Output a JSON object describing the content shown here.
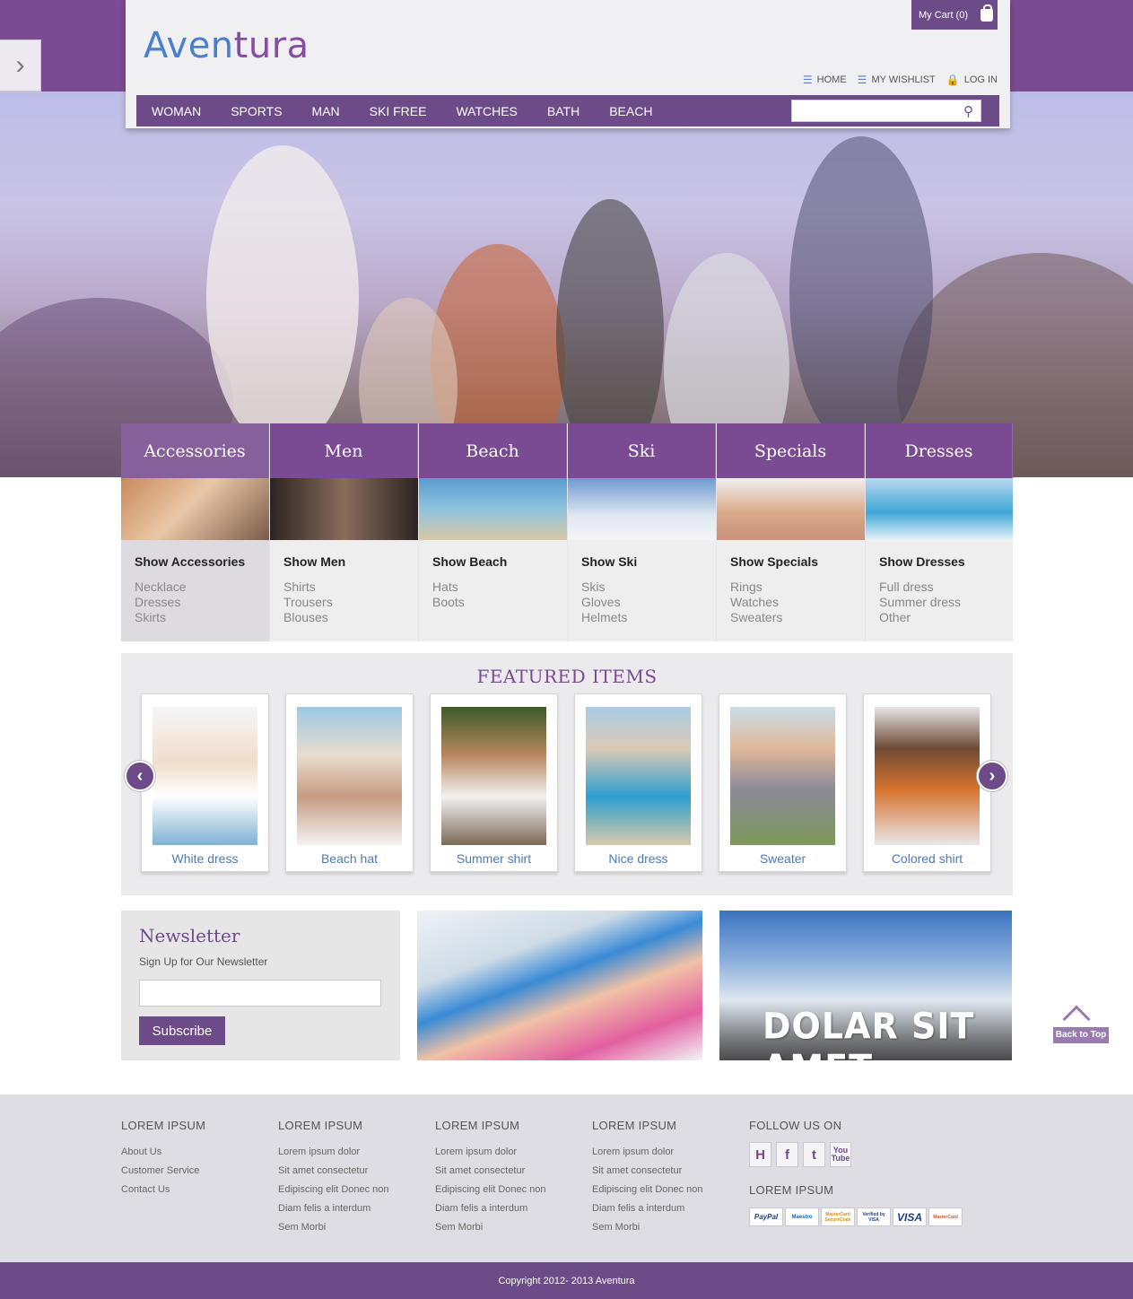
{
  "brand": {
    "logo_main": "Aven",
    "logo_tail": "tura"
  },
  "header": {
    "cart_label": "My Cart (0)",
    "top_links": [
      {
        "label": "HOME",
        "icon": "list-icon"
      },
      {
        "label": "MY WISHLIST",
        "icon": "list-icon"
      },
      {
        "label": "LOG IN",
        "icon": "lock-icon"
      }
    ],
    "nav": [
      "WOMAN",
      "SPORTS",
      "MAN",
      "SKI FREE",
      "WATCHES",
      "BATH",
      "BEACH"
    ],
    "search_placeholder": ""
  },
  "categories": [
    {
      "name": "Accessories",
      "show": "Show Accessories",
      "links": [
        "Necklace",
        "Dresses",
        "Skirts"
      ]
    },
    {
      "name": "Men",
      "show": "Show Men",
      "links": [
        "Shirts",
        "Trousers",
        "Blouses"
      ]
    },
    {
      "name": "Beach",
      "show": "Show Beach",
      "links": [
        "Hats",
        "Boots"
      ]
    },
    {
      "name": "Ski",
      "show": "Show Ski",
      "links": [
        "Skis",
        "Gloves",
        "Helmets"
      ]
    },
    {
      "name": "Specials",
      "show": "Show Specials",
      "links": [
        "Rings",
        "Watches",
        "Sweaters"
      ]
    },
    {
      "name": "Dresses",
      "show": "Show Dresses",
      "links": [
        "Full dress",
        "Summer dress",
        "Other"
      ]
    }
  ],
  "featured": {
    "title": "FEATURED ITEMS",
    "items": [
      "White dress",
      "Beach hat",
      "Summer shirt",
      "Nice dress",
      "Sweater",
      "Colored shirt"
    ]
  },
  "newsletter": {
    "title": "Newsletter",
    "subtitle": "Sign Up for Our Newsletter",
    "input_value": "",
    "button": "Subscribe"
  },
  "promo": {
    "banner_text": "DOLAR SIT AMET"
  },
  "back_to_top": "Back to Top",
  "footer": {
    "columns": [
      {
        "title": "LOREM IPSUM",
        "links": [
          "About Us",
          "Customer Service",
          "Contact Us"
        ]
      },
      {
        "title": "LOREM IPSUM",
        "links": [
          "Lorem ipsum dolor",
          "Sit amet consectetur",
          "Edipiscing elit Donec non",
          "Diam felis a interdum",
          "Sem Morbi"
        ]
      },
      {
        "title": "LOREM IPSUM",
        "links": [
          "Lorem ipsum dolor",
          "Sit amet consectetur",
          "Edipiscing elit Donec non",
          "Diam felis a interdum",
          "Sem Morbi"
        ]
      },
      {
        "title": "LOREM IPSUM",
        "links": [
          "Lorem ipsum dolor",
          "Sit amet consectetur",
          "Edipiscing elit Donec non",
          "Diam felis a interdum",
          "Sem Morbi"
        ]
      }
    ],
    "follow_title": "FOLLOW US ON",
    "social": [
      {
        "label": "H",
        "icon": "hyves-icon"
      },
      {
        "label": "f",
        "icon": "facebook-icon"
      },
      {
        "label": "t",
        "icon": "twitter-icon"
      },
      {
        "label": "You Tube",
        "icon": "youtube-icon"
      }
    ],
    "payments_title": "LOREM IPSUM",
    "payments": [
      "PayPal",
      "Maestro",
      "MasterCard SecureCode",
      "Verified by VISA",
      "VISA",
      "MasterCard"
    ],
    "copyright": "Copyright 2012- 2013 Aventura"
  },
  "colors": {
    "brand_purple": "#6c4b88",
    "accent_blue": "#4f7ab6"
  }
}
